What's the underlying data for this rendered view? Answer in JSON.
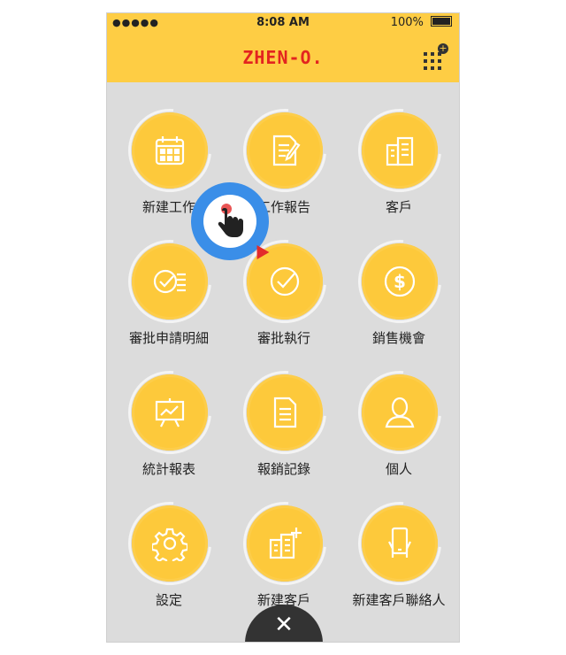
{
  "status_bar": {
    "signal": "●●●●● ",
    "time": "8:08 AM",
    "battery": "100%"
  },
  "header": {
    "logo": "ZHEN-O.",
    "grid_plus": "+"
  },
  "menu": [
    {
      "label": "新建工作",
      "icon": "calendar-icon"
    },
    {
      "label": "工作報告",
      "icon": "report-edit-icon"
    },
    {
      "label": "客戶",
      "icon": "building-icon"
    },
    {
      "label": "審批申請明細",
      "icon": "check-list-icon"
    },
    {
      "label": "審批執行",
      "icon": "check-circle-icon"
    },
    {
      "label": "銷售機會",
      "icon": "dollar-icon"
    },
    {
      "label": "統計報表",
      "icon": "chart-board-icon"
    },
    {
      "label": "報銷記錄",
      "icon": "document-icon"
    },
    {
      "label": "個人",
      "icon": "person-icon"
    },
    {
      "label": "設定",
      "icon": "gear-icon"
    },
    {
      "label": "新建客戶",
      "icon": "building-plus-icon"
    },
    {
      "label": "新建客戶聯絡人",
      "icon": "phone-hand-icon"
    }
  ],
  "close_button": "✕",
  "colors": {
    "header": "#fecd44",
    "tile": "#fdc93b",
    "logo": "#e3241f",
    "tap": "#3a8ee8"
  }
}
